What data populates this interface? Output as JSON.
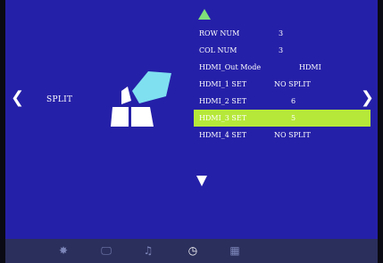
{
  "nav": {
    "left_arrow": "❮",
    "right_arrow": "❯"
  },
  "split_label": "SPLIT",
  "menu": {
    "rows": [
      {
        "label": "ROW NUM",
        "value": "3"
      },
      {
        "label": "COL NUM",
        "value": "3"
      },
      {
        "label": "HDMI_Out Mode",
        "value": "HDMI"
      },
      {
        "label": "HDMI_1 SET",
        "value": "NO SPLIT"
      },
      {
        "label": "HDMI_2 SET",
        "value": "6"
      },
      {
        "label": "HDMI_3 SET",
        "value": "5"
      },
      {
        "label": "HDMI_4 SET",
        "value": "NO SPLIT"
      }
    ],
    "selected_index": 5
  },
  "bottom_bar": {
    "icons": [
      {
        "name": "gear-icon",
        "glyph": "✸"
      },
      {
        "name": "monitor-icon",
        "glyph": "🖵"
      },
      {
        "name": "music-icon",
        "glyph": "♫"
      },
      {
        "name": "clock-icon",
        "glyph": "◷"
      },
      {
        "name": "grid-icon",
        "glyph": "▦"
      }
    ],
    "active_index": 3
  },
  "colors": {
    "background": "#2520a8",
    "highlight": "#b6e83a",
    "up_arrow": "#7fe07a",
    "bottom_bar": "#2b2f5c",
    "split_graphic": "#7fe0f0"
  }
}
